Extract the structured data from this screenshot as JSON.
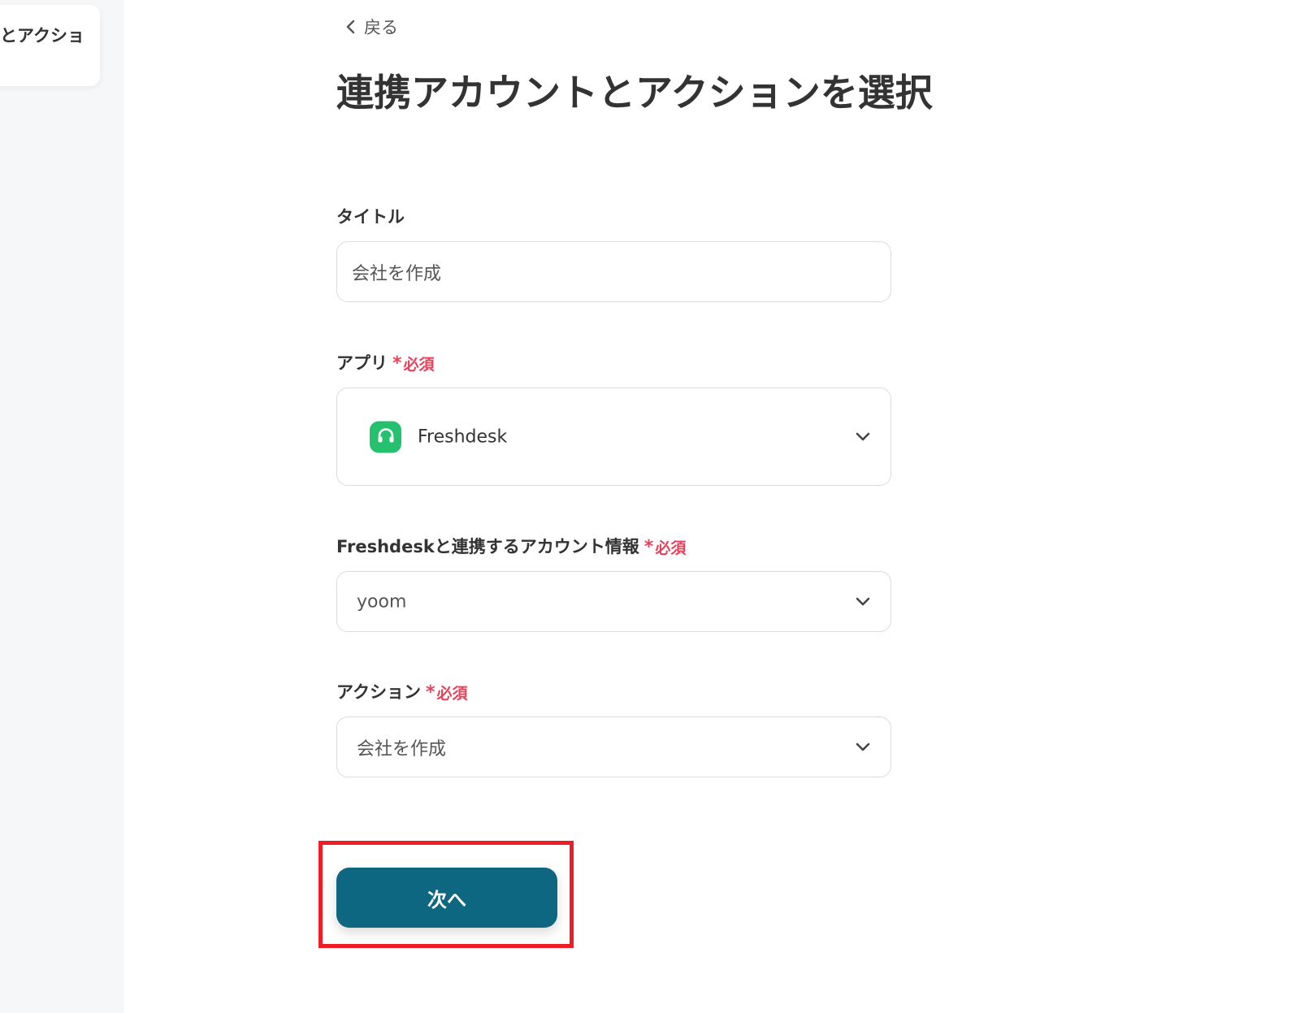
{
  "sidebar": {
    "card_label": "とアクショ"
  },
  "header": {
    "back_label": "戻る",
    "title": "連携アカウントとアクションを選択"
  },
  "form": {
    "title_field": {
      "label": "タイトル",
      "value": "会社を作成"
    },
    "app_field": {
      "label": "アプリ",
      "required": "必須",
      "required_mark": "*",
      "value": "Freshdesk",
      "icon": "freshdesk-headset-icon"
    },
    "account_field": {
      "label": "Freshdeskと連携するアカウント情報",
      "required": "必須",
      "required_mark": "*",
      "value": "yoom"
    },
    "action_field": {
      "label": "アクション",
      "required": "必須",
      "required_mark": "*",
      "value": "会社を作成"
    }
  },
  "next_button": {
    "label": "次へ"
  },
  "colors": {
    "accent": "#0d6781",
    "required": "#e8425a",
    "freshdesk": "#25c16f",
    "highlight": "#ee1c25"
  }
}
